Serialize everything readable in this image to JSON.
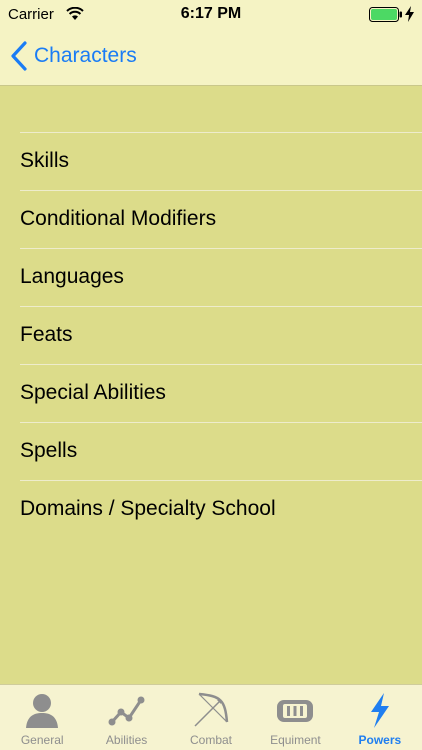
{
  "status_bar": {
    "carrier": "Carrier",
    "time": "6:17 PM",
    "wifi_icon": "wifi-icon",
    "battery_icon": "battery-icon",
    "charging_icon": "charging-bolt-icon"
  },
  "nav": {
    "back_label": "Characters",
    "back_icon": "chevron-left-icon"
  },
  "list": {
    "items": [
      {
        "label": "Skills"
      },
      {
        "label": "Conditional Modifiers"
      },
      {
        "label": "Languages"
      },
      {
        "label": "Feats"
      },
      {
        "label": "Special Abilities"
      },
      {
        "label": "Spells"
      },
      {
        "label": "Domains / Specialty School"
      }
    ]
  },
  "tab_bar": {
    "tabs": [
      {
        "label": "General",
        "icon": "person-icon",
        "active": false
      },
      {
        "label": "Abilities",
        "icon": "line-graph-icon",
        "active": false
      },
      {
        "label": "Combat",
        "icon": "bow-icon",
        "active": false
      },
      {
        "label": "Equiment",
        "icon": "gear-icon",
        "active": false
      },
      {
        "label": "Powers",
        "icon": "lightning-icon",
        "active": true
      }
    ]
  },
  "colors": {
    "background": "#dcdc8a",
    "bar": "#f5f3c4",
    "accent": "#1a7cf5",
    "inactive": "#8e8e8e"
  }
}
